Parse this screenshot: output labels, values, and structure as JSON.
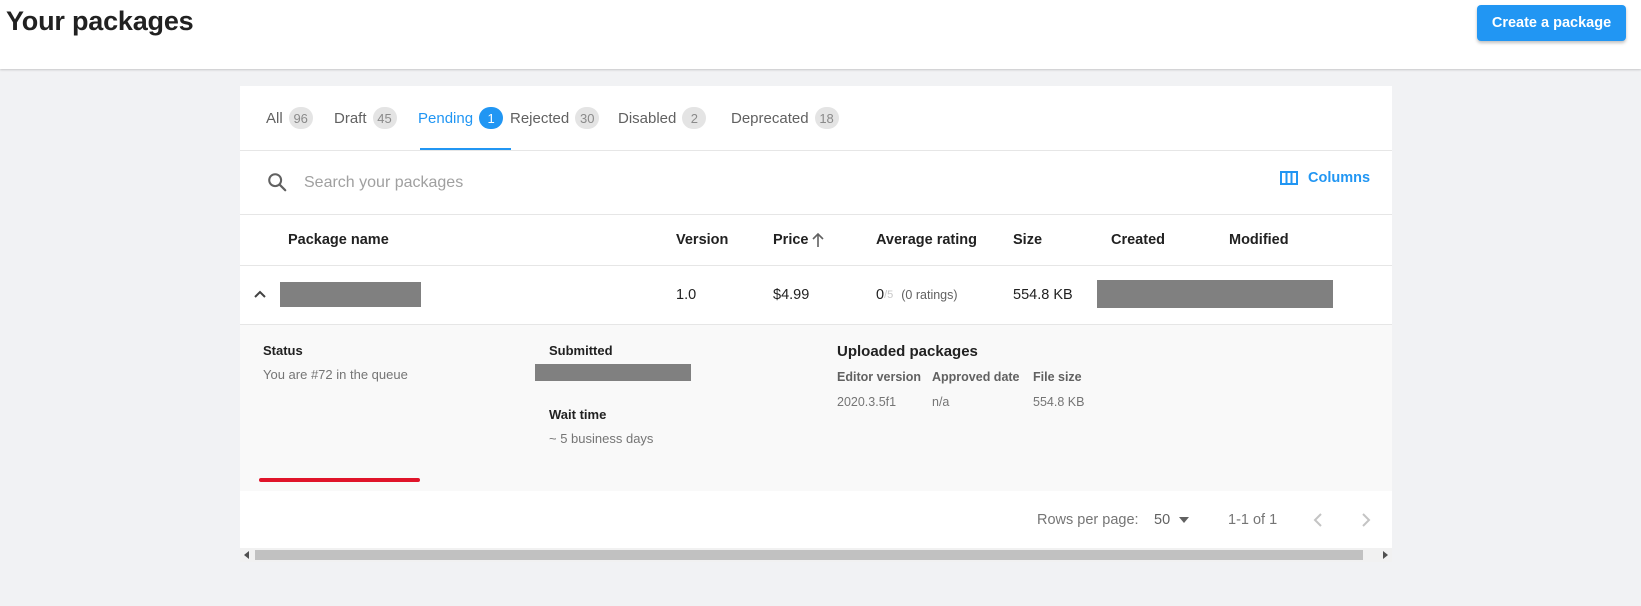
{
  "header": {
    "title": "Your packages",
    "create_button": "Create a package"
  },
  "tabs": [
    {
      "label": "All",
      "count": "96"
    },
    {
      "label": "Draft",
      "count": "45"
    },
    {
      "label": "Pending",
      "count": "1",
      "active": true
    },
    {
      "label": "Rejected",
      "count": "30"
    },
    {
      "label": "Disabled",
      "count": "2"
    },
    {
      "label": "Deprecated",
      "count": "18"
    }
  ],
  "search": {
    "placeholder": "Search your packages",
    "value": ""
  },
  "columns_button": "Columns",
  "table": {
    "headers": {
      "name": "Package name",
      "version": "Version",
      "price": "Price",
      "rating": "Average rating",
      "size": "Size",
      "created": "Created",
      "modified": "Modified"
    },
    "sort": {
      "column": "price",
      "direction": "ascending"
    },
    "rows": [
      {
        "version": "1.0",
        "price": "$4.99",
        "rating_value": "0",
        "rating_max": "/5",
        "rating_count": "(0 ratings)",
        "size": "554.8 KB"
      }
    ]
  },
  "details": {
    "status_label": "Status",
    "status_value": "You are #72 in the queue",
    "submitted_label": "Submitted",
    "wait_label": "Wait time",
    "wait_value": "~ 5 business days",
    "uploaded_title": "Uploaded packages",
    "uploaded_headers": {
      "editor": "Editor version",
      "approved": "Approved date",
      "filesize": "File size"
    },
    "uploaded_rows": [
      {
        "editor": "2020.3.5f1",
        "approved": "n/a",
        "filesize": "554.8 KB"
      }
    ]
  },
  "pagination": {
    "rows_per_page_label": "Rows per page:",
    "rows_per_page_value": "50",
    "range": "1-1 of 1"
  },
  "colors": {
    "accent": "#2196f3",
    "annotation": "#e0142a"
  }
}
